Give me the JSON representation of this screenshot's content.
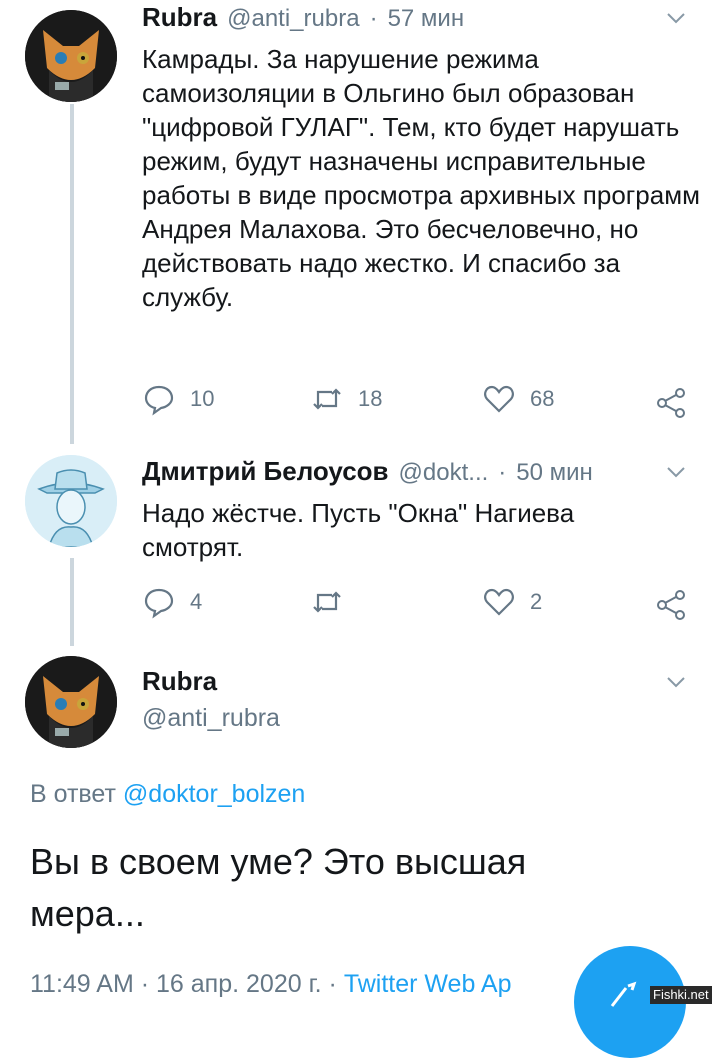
{
  "tweet1": {
    "name": "Rubra",
    "handle": "@anti_rubra",
    "sep": "·",
    "time": "57 мин",
    "text": "Камрады. За нарушение режима самоизоляции в Ольгино был образован \"цифровой ГУЛАГ\". Тем, кто будет нарушать режим, будут назначены исправительные работы в виде просмотра архивных программ Андрея Малахова. Это бесчеловечно, но действовать надо жестко. И спасибо за службу.",
    "replies": "10",
    "retweets": "18",
    "likes": "68"
  },
  "tweet2": {
    "name": "Дмитрий Белоусов",
    "handle": "@dokt...",
    "sep": "·",
    "time": "50 мин",
    "text": "Надо жёстче. Пусть \"Окна\" Нагиева смотрят.",
    "replies": "4",
    "retweets": "",
    "likes": "2"
  },
  "tweet3": {
    "name": "Rubra",
    "handle": "@anti_rubra",
    "reply_prefix": "В ответ",
    "reply_to": "@doktor_bolzen",
    "text": "Вы в своем уме? Это высшая мера...",
    "time": "11:49 AM",
    "date": "16 апр. 2020 г.",
    "sep": "·",
    "source": "Twitter Web Ap"
  },
  "watermark": "Fishki.net",
  "colors": {
    "accent": "#1da1f2",
    "muted": "#657786",
    "thread": "#ccd6dd"
  },
  "icons": [
    "reply-icon",
    "retweet-icon",
    "like-icon",
    "share-icon",
    "chevron-down-icon",
    "compose-fab"
  ]
}
